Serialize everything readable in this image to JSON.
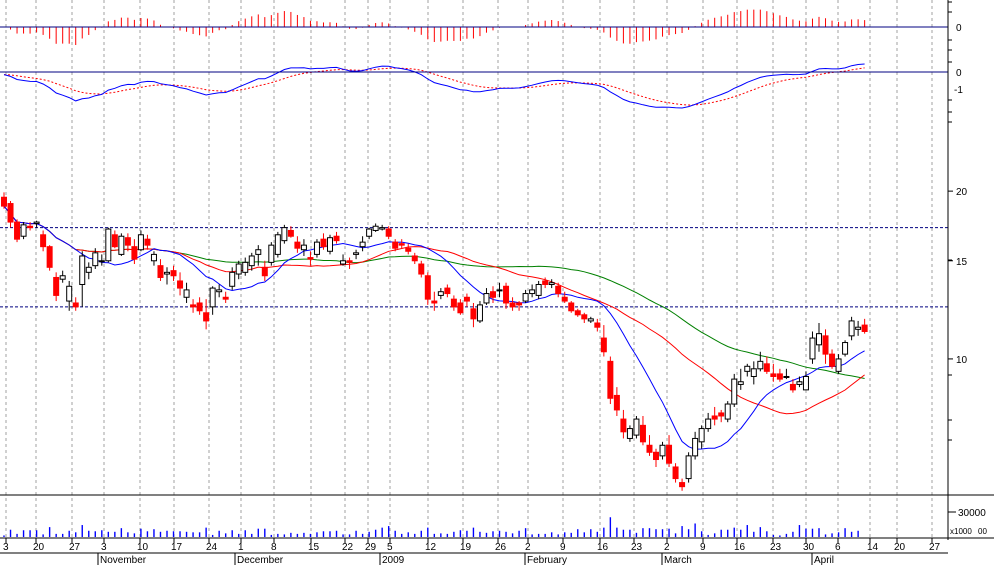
{
  "chart_data": {
    "type": "candlestick",
    "panels": [
      "macd_histogram",
      "macd_lines",
      "price",
      "volume"
    ],
    "x_axis": {
      "day_labels": [
        "3",
        "20",
        "27",
        "3",
        "10",
        "17",
        "24",
        "1",
        "8",
        "15",
        "22",
        "29",
        "5",
        "12",
        "19",
        "26",
        "2",
        "9",
        "16",
        "23",
        "2",
        "9",
        "16",
        "23",
        "30",
        "6",
        "14",
        "20",
        "27"
      ],
      "month_labels": [
        "November",
        "December",
        "2009",
        "February",
        "March",
        "April"
      ]
    },
    "price_axis": {
      "scale": "log",
      "ticks": [
        "20",
        "15",
        "10"
      ],
      "tick_values": [
        20,
        15,
        10
      ],
      "ylim": [
        5.7,
        24.5
      ]
    },
    "macd_axis": {
      "ticks": [
        "0",
        "0",
        "-1"
      ]
    },
    "volume_axis": {
      "ticks": [
        "30000",
        "x1000",
        "00"
      ]
    },
    "reference_lines": [
      17.2,
      12.4
    ],
    "colors": {
      "up": "#ffffff",
      "down": "#ff0000",
      "sma_short": "#0000ff",
      "sma_mid": "#ff0000",
      "sma_long": "#008000",
      "macd": "#0000ff",
      "signal": "#ff0000",
      "volume": "#0000ff",
      "histogram": "#ff0000",
      "axis": "#000080"
    },
    "candles": [
      [
        19.5,
        19.9,
        18.6,
        18.8
      ],
      [
        19.0,
        19.2,
        17.2,
        17.6
      ],
      [
        17.6,
        17.8,
        16.2,
        16.4
      ],
      [
        16.6,
        17.6,
        16.4,
        17.4
      ],
      [
        17.3,
        17.6,
        17.0,
        17.2
      ],
      [
        17.5,
        17.7,
        17.2,
        17.6
      ],
      [
        16.7,
        17.0,
        15.6,
        15.9
      ],
      [
        15.9,
        16.0,
        14.4,
        14.6
      ],
      [
        14.0,
        14.3,
        12.7,
        13.0
      ],
      [
        13.9,
        14.4,
        13.7,
        14.1
      ],
      [
        12.7,
        13.8,
        12.2,
        13.5
      ],
      [
        12.6,
        12.9,
        12.2,
        12.4
      ],
      [
        13.6,
        15.6,
        12.4,
        15.3
      ],
      [
        14.3,
        14.9,
        13.9,
        14.6
      ],
      [
        14.7,
        15.8,
        14.5,
        15.5
      ],
      [
        15.0,
        15.4,
        14.7,
        15.0
      ],
      [
        15.0,
        17.2,
        14.9,
        17.1
      ],
      [
        16.7,
        17.0,
        15.8,
        15.9
      ],
      [
        15.4,
        16.8,
        15.3,
        16.6
      ],
      [
        16.5,
        16.8,
        15.6,
        16.0
      ],
      [
        15.9,
        16.4,
        14.8,
        15.1
      ],
      [
        15.7,
        17.0,
        15.6,
        16.7
      ],
      [
        16.4,
        16.7,
        15.7,
        16.0
      ],
      [
        15.0,
        15.6,
        14.7,
        15.4
      ],
      [
        14.7,
        15.1,
        13.8,
        14.0
      ],
      [
        14.2,
        14.6,
        13.6,
        14.3
      ],
      [
        14.4,
        14.7,
        13.8,
        14.1
      ],
      [
        13.8,
        14.3,
        13.0,
        13.4
      ],
      [
        12.9,
        13.7,
        12.6,
        13.3
      ],
      [
        12.5,
        12.8,
        12.1,
        12.4
      ],
      [
        12.6,
        12.9,
        12.0,
        12.2
      ],
      [
        12.1,
        12.8,
        11.3,
        11.7
      ],
      [
        12.4,
        13.5,
        12.0,
        13.4
      ],
      [
        13.2,
        13.6,
        12.9,
        13.3
      ],
      [
        12.9,
        13.2,
        12.6,
        12.8
      ],
      [
        13.5,
        14.6,
        13.3,
        14.3
      ],
      [
        14.2,
        15.0,
        13.9,
        14.8
      ],
      [
        14.3,
        15.2,
        14.1,
        14.9
      ],
      [
        14.7,
        15.5,
        14.4,
        15.3
      ],
      [
        15.4,
        16.0,
        14.7,
        15.7
      ],
      [
        14.6,
        15.0,
        13.8,
        14.1
      ],
      [
        14.9,
        16.2,
        14.7,
        16.0
      ],
      [
        15.4,
        16.9,
        15.2,
        16.7
      ],
      [
        16.3,
        17.4,
        16.1,
        17.2
      ],
      [
        17.0,
        17.3,
        16.5,
        16.6
      ],
      [
        16.2,
        16.6,
        15.5,
        15.8
      ],
      [
        15.7,
        16.4,
        15.3,
        16.0
      ],
      [
        15.2,
        15.6,
        14.7,
        15.1
      ],
      [
        15.4,
        16.4,
        15.2,
        16.2
      ],
      [
        16.4,
        16.8,
        15.7,
        15.9
      ],
      [
        15.6,
        16.7,
        15.4,
        16.5
      ],
      [
        16.6,
        16.9,
        16.1,
        16.3
      ],
      [
        14.8,
        15.4,
        14.7,
        15.0
      ],
      [
        15.0,
        15.2,
        14.5,
        14.9
      ],
      [
        15.4,
        15.7,
        15.1,
        15.5
      ],
      [
        15.9,
        16.6,
        15.6,
        16.2
      ],
      [
        16.6,
        17.2,
        16.4,
        17.1
      ],
      [
        17.0,
        17.5,
        16.9,
        17.3
      ],
      [
        17.1,
        17.4,
        17.0,
        17.2
      ],
      [
        17.1,
        17.3,
        16.4,
        16.6
      ],
      [
        16.2,
        16.4,
        15.6,
        15.8
      ],
      [
        16.1,
        16.4,
        15.8,
        16.0
      ],
      [
        15.8,
        16.1,
        15.4,
        15.6
      ],
      [
        15.3,
        15.5,
        14.8,
        15.0
      ],
      [
        14.8,
        15.0,
        14.0,
        14.2
      ],
      [
        14.1,
        14.3,
        12.5,
        12.8
      ],
      [
        12.7,
        13.2,
        12.2,
        12.6
      ],
      [
        13.0,
        13.4,
        12.8,
        13.2
      ],
      [
        13.4,
        13.6,
        12.9,
        13.1
      ],
      [
        12.8,
        13.0,
        12.2,
        12.4
      ],
      [
        12.6,
        12.8,
        12.0,
        12.1
      ],
      [
        12.9,
        13.1,
        12.4,
        12.7
      ],
      [
        12.3,
        12.6,
        11.4,
        11.8
      ],
      [
        11.7,
        12.7,
        11.6,
        12.5
      ],
      [
        12.6,
        13.4,
        12.5,
        13.1
      ],
      [
        13.2,
        13.5,
        12.6,
        12.9
      ],
      [
        13.3,
        13.7,
        12.9,
        13.3
      ],
      [
        13.5,
        13.7,
        12.3,
        12.6
      ],
      [
        12.6,
        12.9,
        12.2,
        12.4
      ],
      [
        12.6,
        12.7,
        12.2,
        12.5
      ],
      [
        12.7,
        13.3,
        12.6,
        13.1
      ],
      [
        13.1,
        13.6,
        12.9,
        13.3
      ],
      [
        13.0,
        13.8,
        12.8,
        13.6
      ],
      [
        13.8,
        14.0,
        13.4,
        13.6
      ],
      [
        13.6,
        13.9,
        13.4,
        13.7
      ],
      [
        13.5,
        13.7,
        12.9,
        13.1
      ],
      [
        12.9,
        13.2,
        12.6,
        12.7
      ],
      [
        12.6,
        12.7,
        12.1,
        12.2
      ],
      [
        12.2,
        12.3,
        11.9,
        12.0
      ],
      [
        12.0,
        12.1,
        11.6,
        11.8
      ],
      [
        11.7,
        11.9,
        11.6,
        11.8
      ],
      [
        11.6,
        11.8,
        11.2,
        11.4
      ],
      [
        10.9,
        11.5,
        10.1,
        10.3
      ],
      [
        9.9,
        10.1,
        8.3,
        8.5
      ],
      [
        8.6,
        8.9,
        7.9,
        8.1
      ],
      [
        7.8,
        8.1,
        7.2,
        7.4
      ],
      [
        7.2,
        7.6,
        7.1,
        7.5
      ],
      [
        7.3,
        7.9,
        7.2,
        7.8
      ],
      [
        7.6,
        7.9,
        7.0,
        7.1
      ],
      [
        7.0,
        7.3,
        6.7,
        6.8
      ],
      [
        6.8,
        6.9,
        6.4,
        6.6
      ],
      [
        6.7,
        7.1,
        6.6,
        7.0
      ],
      [
        7.0,
        7.3,
        6.4,
        6.5
      ],
      [
        6.4,
        6.5,
        6.0,
        6.1
      ],
      [
        6.0,
        6.1,
        5.8,
        5.9
      ],
      [
        6.1,
        6.8,
        6.0,
        6.7
      ],
      [
        6.7,
        7.4,
        6.6,
        7.2
      ],
      [
        7.1,
        7.6,
        6.9,
        7.5
      ],
      [
        7.5,
        8.0,
        7.4,
        7.8
      ],
      [
        7.9,
        8.2,
        7.6,
        7.8
      ],
      [
        8.0,
        8.1,
        7.7,
        7.9
      ],
      [
        7.8,
        8.4,
        7.7,
        8.3
      ],
      [
        8.3,
        9.4,
        8.2,
        9.2
      ],
      [
        9.0,
        9.6,
        8.8,
        9.1
      ],
      [
        9.5,
        9.8,
        9.3,
        9.7
      ],
      [
        9.3,
        9.9,
        9.0,
        9.6
      ],
      [
        9.6,
        10.3,
        9.5,
        9.9
      ],
      [
        9.8,
        10.1,
        9.4,
        9.5
      ],
      [
        9.4,
        9.8,
        9.1,
        9.3
      ],
      [
        9.4,
        9.6,
        9.1,
        9.2
      ],
      [
        9.3,
        9.6,
        9.2,
        9.3
      ],
      [
        9.0,
        9.2,
        8.7,
        8.8
      ],
      [
        9.0,
        9.3,
        8.9,
        9.1
      ],
      [
        8.8,
        9.5,
        8.8,
        9.3
      ],
      [
        10.0,
        11.2,
        9.8,
        10.9
      ],
      [
        10.6,
        11.6,
        10.3,
        11.1
      ],
      [
        11.0,
        11.3,
        9.8,
        10.2
      ],
      [
        10.2,
        10.4,
        9.6,
        9.7
      ],
      [
        9.5,
        10.2,
        9.4,
        10.0
      ],
      [
        10.2,
        10.8,
        10.1,
        10.7
      ],
      [
        11.0,
        11.9,
        10.8,
        11.7
      ],
      [
        11.3,
        11.7,
        11.0,
        11.4
      ],
      [
        11.5,
        11.8,
        11.1,
        11.2
      ]
    ],
    "volume": [
      3,
      14,
      6,
      13,
      13,
      13,
      5,
      19,
      6,
      6,
      12,
      9,
      23,
      12,
      11,
      13,
      10,
      10,
      17,
      9,
      7,
      16,
      11,
      15,
      10,
      12,
      11,
      11,
      10,
      9,
      9,
      18,
      4,
      12,
      7,
      13,
      6,
      13,
      6,
      16,
      16,
      4,
      6,
      5,
      8,
      6,
      8,
      6,
      9,
      11,
      11,
      12,
      5,
      5,
      12,
      6,
      10,
      14,
      18,
      21,
      12,
      6,
      9,
      6,
      12,
      18,
      6,
      7,
      6,
      10,
      13,
      12,
      18,
      10,
      8,
      11,
      12,
      10,
      7,
      12,
      17,
      5,
      6,
      6,
      9,
      5,
      9,
      8,
      15,
      9,
      15,
      10,
      18,
      38,
      18,
      14,
      14,
      8,
      17,
      17,
      15,
      15,
      16,
      7,
      21,
      15,
      26,
      11,
      4,
      7,
      14,
      14,
      18,
      14,
      23,
      10,
      19,
      11,
      4,
      3,
      6,
      10,
      23,
      16,
      16,
      17,
      5,
      7,
      9,
      17,
      10,
      12
    ]
  }
}
